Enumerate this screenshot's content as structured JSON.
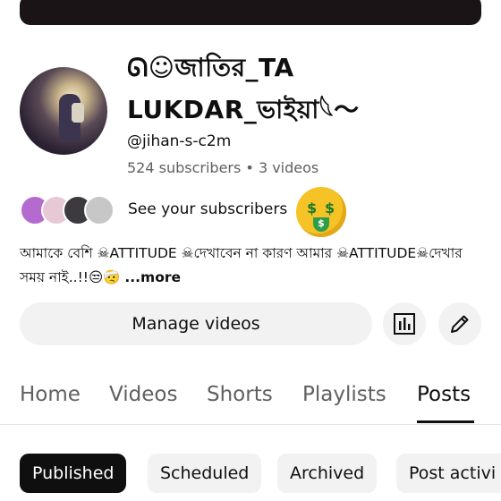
{
  "channel": {
    "name": "ᘏ☺জাতির_TA LUKDAR_ভাইয়া𓆩〜",
    "handle": "@jihan-s-c2m",
    "stats": "524 subscribers • 3 videos"
  },
  "subscribers": {
    "label": "See your subscribers"
  },
  "bio": {
    "text": "আমাকে বেশি ☠ATTITUDE ☠দেখাবেন না কারণ আমার ☠ATTITUDE☠দেখার সময় নাই..!!😒🤕",
    "more_label": "...more"
  },
  "actions": {
    "manage_label": "Manage videos",
    "analytics_icon": "analytics-icon",
    "edit_icon": "pencil-icon"
  },
  "tabs": [
    {
      "label": "Home"
    },
    {
      "label": "Videos"
    },
    {
      "label": "Shorts"
    },
    {
      "label": "Playlists"
    },
    {
      "label": "Posts",
      "active": true
    }
  ],
  "chips": [
    {
      "label": "Published",
      "active": true
    },
    {
      "label": "Scheduled"
    },
    {
      "label": "Archived"
    },
    {
      "label": "Post activi"
    }
  ],
  "colors": {
    "text": "#0f0f0f",
    "secondary": "#606060",
    "chip_bg": "#f2f2f2",
    "active_chip_bg": "#0f0f0f"
  }
}
